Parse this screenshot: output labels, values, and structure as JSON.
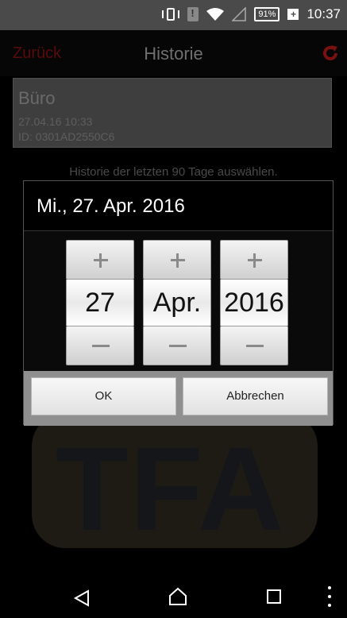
{
  "statusbar": {
    "battery": "91%",
    "time": "10:37"
  },
  "header": {
    "back_label": "Zurück",
    "title": "Historie",
    "refresh_icon": "refresh-icon"
  },
  "device": {
    "name": "Büro",
    "timestamp": "27.04.16  10:33",
    "id": "ID: 0301AD2550C6"
  },
  "hint": "Historie der letzten 90 Tage auswählen.",
  "background_logo": "TFA",
  "date_dialog": {
    "title": "Mi., 27. Apr. 2016",
    "day": "27",
    "month": "Apr.",
    "year": "2016",
    "ok_label": "OK",
    "cancel_label": "Abbrechen"
  },
  "colors": {
    "back_accent": "#5a0a0a",
    "refresh_accent": "#7a1010"
  }
}
